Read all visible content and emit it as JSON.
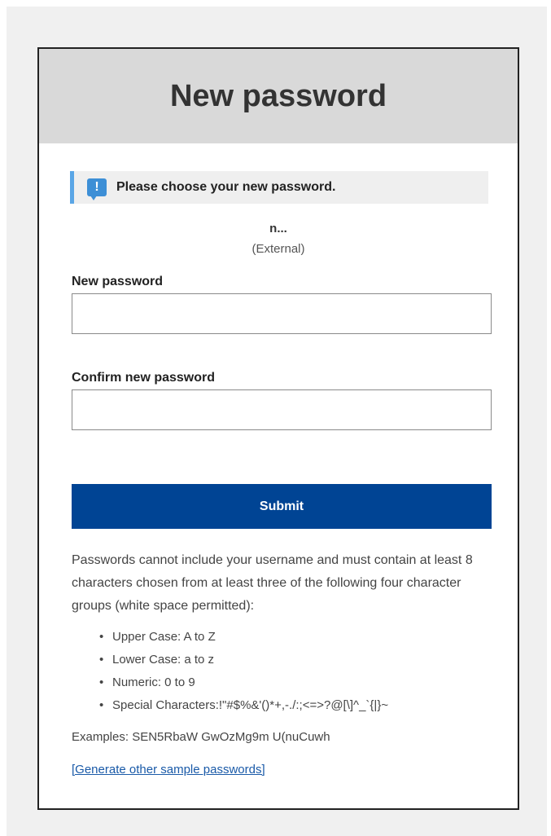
{
  "header": {
    "title": "New password"
  },
  "notice": {
    "text": "Please choose your new password."
  },
  "user": {
    "name": "n...",
    "type": "(External)"
  },
  "form": {
    "new_password": {
      "label": "New password",
      "value": "",
      "placeholder": ""
    },
    "confirm_password": {
      "label": "Confirm new password",
      "value": "",
      "placeholder": ""
    },
    "submit_label": "Submit"
  },
  "rules": {
    "intro": "Passwords cannot include your username and must contain at least 8 characters chosen from at least three of the following four character groups (white space permitted):",
    "items": [
      "Upper Case: A to Z",
      "Lower Case: a to z",
      "Numeric: 0 to 9",
      "Special Characters:!\"#$%&'()*+,-./:;<=>?@[\\]^_`{|}~"
    ],
    "examples": "Examples: SEN5RbaW GwOzMg9m U(nuCuwh",
    "generate_link": "[Generate other sample passwords]"
  },
  "colors": {
    "header_bg": "#d9d9d9",
    "submit_bg": "#004494",
    "notice_accent": "#5aa6e6",
    "link": "#1a5aa8"
  },
  "icons": {
    "notice": "info-speech-icon"
  }
}
